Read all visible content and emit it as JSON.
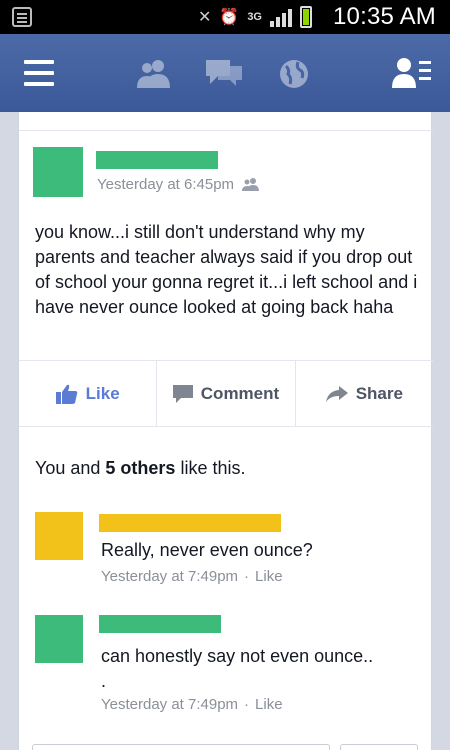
{
  "status_bar": {
    "network": "3G",
    "time": "10:35 AM"
  },
  "post": {
    "timestamp": "Yesterday at 6:45pm",
    "text": "you know...i still don't understand why my parents and teacher always said if you drop out of school your gonna regret it...i left school and i have never ounce looked at going back haha"
  },
  "actions": {
    "like": "Like",
    "comment": "Comment",
    "share": "Share"
  },
  "likes": {
    "prefix": "You and ",
    "count": "5 others",
    "suffix": " like this."
  },
  "comments": [
    {
      "text": "Really, never even ounce?",
      "timestamp": "Yesterday at 7:49pm",
      "like": "Like"
    },
    {
      "text": "can honestly say not even ounce..",
      "text2": ".",
      "timestamp": "Yesterday at 7:49pm",
      "like": "Like"
    }
  ],
  "colors": {
    "facebook_blue": "#3b5998",
    "redaction_green": "#3dbb7a",
    "redaction_yellow": "#f2c21b",
    "like_blue": "#5b7bd5"
  }
}
